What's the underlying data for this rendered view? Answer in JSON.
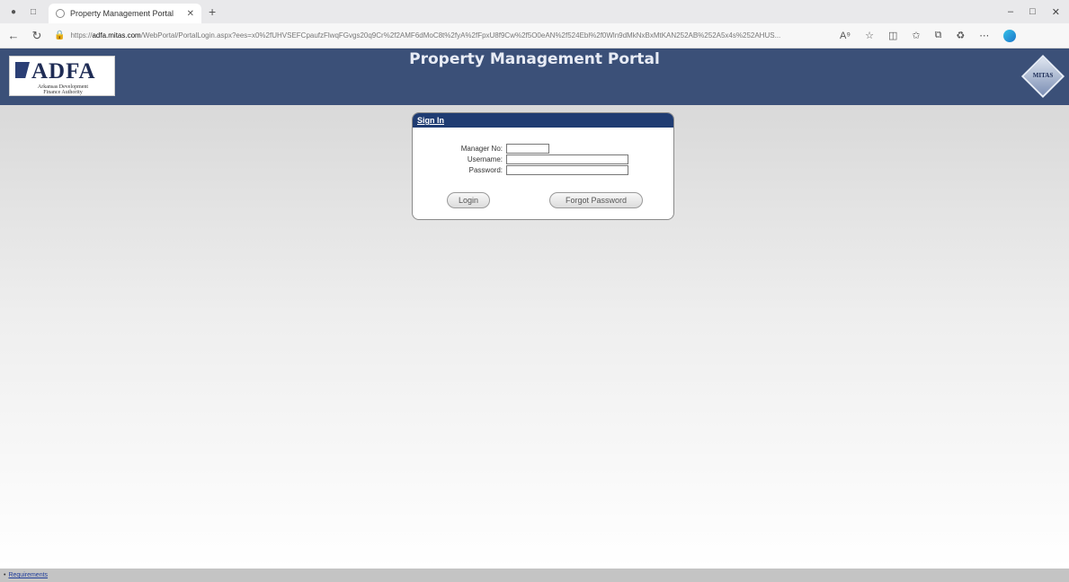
{
  "browser": {
    "tab_title": "Property Management Portal",
    "url_prefix": "https://",
    "url_domain": "adfa.mitas.com",
    "url_rest": "/WebPortal/PortalLogin.aspx?ees=x0%2fUHVSEFCpaufzFlwqFGvgs20q9Cr%2f2AMF6dMoC8t%2fyA%2fFpxU8f9Cw%2f5O0eAN%2f524Ebl%2f0Wln9dMkNxBxMtKAN252AB%252A5x4s%252AHUS...",
    "icons": [
      "back-icon",
      "refresh-icon",
      "lock-icon",
      "read-aloud-icon",
      "favorite-icon",
      "split-screen-icon",
      "favorites-bar-icon",
      "collections-icon",
      "extensions-icon",
      "more-icon",
      "edge-icon"
    ]
  },
  "header": {
    "logo_text": "ADFA",
    "logo_sub1": "Arkansas Development",
    "logo_sub2": "Finance Authority",
    "title": "Property Management Portal",
    "mitas_text": "MITAS"
  },
  "signin": {
    "heading": "Sign In",
    "manager_label": "Manager No:",
    "username_label": "Username:",
    "password_label": "Password:",
    "manager_value": "",
    "username_value": "",
    "password_value": "",
    "login_button": "Login",
    "forgot_button": "Forgot Password"
  },
  "footer": {
    "link": "Requirements"
  },
  "colors": {
    "header_bg": "#3b5078",
    "signin_head_bg": "#1f3c72",
    "footer_bg": "#c4c4c4"
  }
}
